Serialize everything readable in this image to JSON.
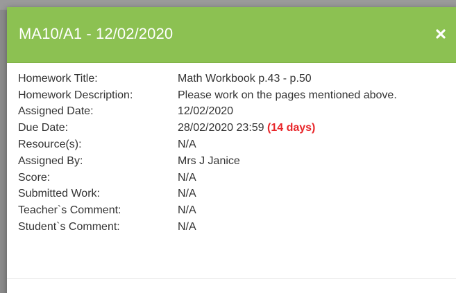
{
  "modal": {
    "title": "MA10/A1 - 12/02/2020",
    "close_icon": "close-icon"
  },
  "details": [
    {
      "label": "Homework Title:",
      "value": "Math Workbook p.43 - p.50"
    },
    {
      "label": "Homework Description:",
      "value": "Please work on the pages mentioned above."
    },
    {
      "label": "Assigned Date:",
      "value": "12/02/2020"
    },
    {
      "label": "Due Date:",
      "value": "28/02/2020 23:59",
      "extra": "(14 days)"
    },
    {
      "label": "Resource(s):",
      "value": "N/A"
    },
    {
      "label": "Assigned By:",
      "value": "Mrs J Janice"
    },
    {
      "label": "Score:",
      "value": "N/A"
    },
    {
      "label": "Submitted Work:",
      "value": "N/A"
    },
    {
      "label": "Teacher`s Comment:",
      "value": "N/A"
    },
    {
      "label": "Student`s Comment:",
      "value": "N/A"
    }
  ],
  "colors": {
    "header": "#8cc152",
    "overdue": "#e8262a"
  }
}
